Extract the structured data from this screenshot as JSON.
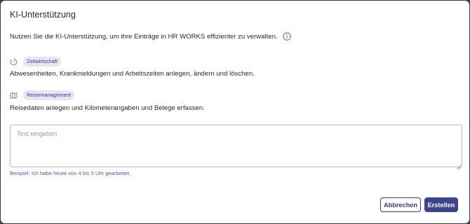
{
  "dialog": {
    "title": "KI-Unterstützung",
    "intro": "Nutzen Sie die KI-Unterstützung, um ihre Einträge in HR WORKS effizienter zu verwalten.",
    "info_icon": "info-icon"
  },
  "sections": [
    {
      "icon": "timer-icon",
      "badge": "Zeitwirtschaft",
      "description": "Abwesenheiten, Krankmeldungen und Arbeitszeiten anlegen, ändern und löschen."
    },
    {
      "icon": "map-icon",
      "badge": "Reisemanagement",
      "description": "Reisedaten anlegen und Kilometerangaben und Belege erfassen."
    }
  ],
  "input": {
    "value": "",
    "placeholder": "Text eingeben"
  },
  "example": "Beispiel: Ich habe heute von 4 bis 5 Uhr gearbeitet.",
  "buttons": {
    "cancel": "Abbrechen",
    "create": "Erstellen"
  },
  "colors": {
    "accent": "#3c4390",
    "badge_bg": "#e4e6f6",
    "example_text": "#5060a8"
  }
}
